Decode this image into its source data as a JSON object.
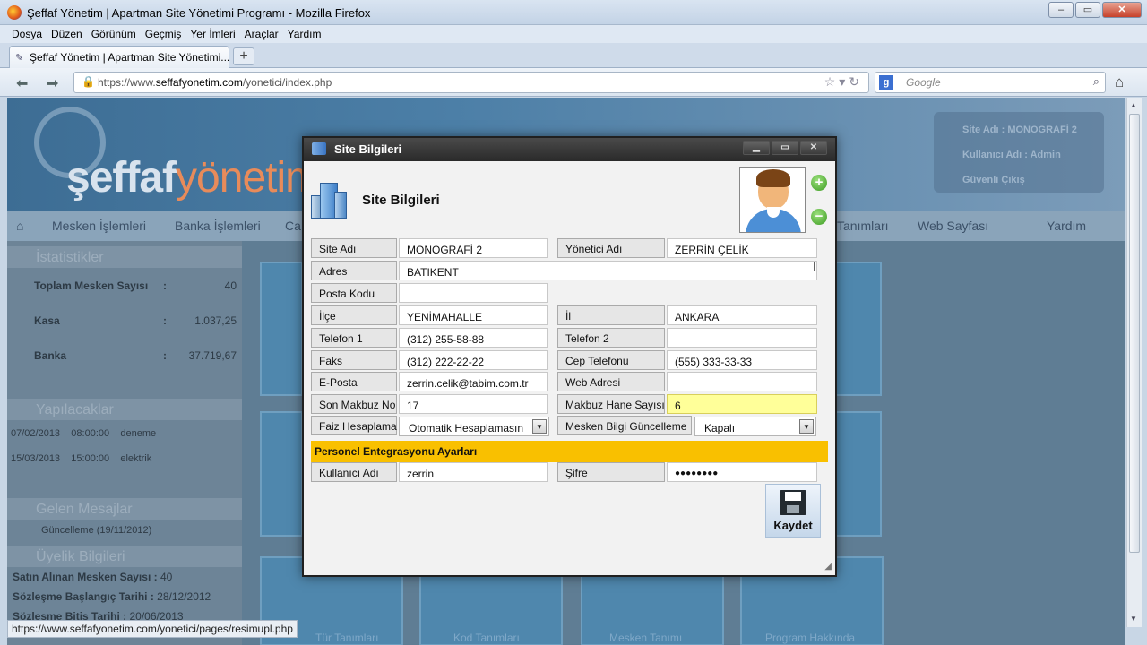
{
  "browser": {
    "window_title": "Şeffaf Yönetim | Apartman Site Yönetimi Programı - Mozilla Firefox",
    "menu": [
      "Dosya",
      "Düzen",
      "Görünüm",
      "Geçmiş",
      "Yer İmleri",
      "Araçlar",
      "Yardım"
    ],
    "tab_title": "Şeffaf Yönetim | Apartman Site Yönetimi...",
    "url_prefix": "https://www.",
    "url_domain": "seffafyonetim.com",
    "url_path": "/yonetici/index.php",
    "search_placeholder": "Google",
    "status_url": "https://www.seffafyonetim.com/yonetici/pages/resimupl.php"
  },
  "site": {
    "logo_main": "şeffaf",
    "logo_accent": "yönetim",
    "nav": [
      "Mesken İşlemleri",
      "Banka İşlemleri",
      "Ca",
      "Tanımları",
      "Web Sayfası",
      "Yardım"
    ],
    "user_box": {
      "site_name": "Site Adı : MONOGRAFİ 2",
      "user_name": "Kullanıcı Adı : Admin",
      "logout": "Güvenli Çıkış"
    },
    "sections": {
      "stats": "İstatistikler",
      "todo": "Yapılacaklar",
      "messages": "Gelen Mesajlar",
      "membership": "Üyelik Bilgileri"
    },
    "stats": [
      {
        "label": "Toplam Mesken Sayısı",
        "value": "40"
      },
      {
        "label": "Kasa",
        "value": "1.037,25"
      },
      {
        "label": "Banka",
        "value": "37.719,67"
      }
    ],
    "todo": [
      {
        "date": "07/02/2013",
        "time": "08:00:00",
        "text": "deneme"
      },
      {
        "date": "15/03/2013",
        "time": "15:00:00",
        "text": "elektrik"
      }
    ],
    "message": "Güncelleme (19/11/2012)",
    "membership": [
      {
        "label": "Satın Alınan Mesken Sayısı",
        "value": "40"
      },
      {
        "label": "Sözleşme Başlangıç Tarihi",
        "value": "28/12/2012"
      },
      {
        "label": "Sözleşme Bitiş Tarihi",
        "value": "20/06/2013"
      }
    ],
    "tile_labels": [
      "Tür Tanımları",
      "Kod Tanımları",
      "Mesken Tanımı",
      "Program Hakkında"
    ]
  },
  "dialog": {
    "title": "Site Bilgileri",
    "heading": "Site Bilgileri",
    "fields": {
      "site_adi": {
        "label": "Site Adı",
        "value": "MONOGRAFİ 2"
      },
      "yonetici_adi": {
        "label": "Yönetici Adı",
        "value": "ZERRİN ÇELİK"
      },
      "adres": {
        "label": "Adres",
        "value": "BATIKENT"
      },
      "posta_kodu": {
        "label": "Posta Kodu",
        "value": ""
      },
      "ilce": {
        "label": "İlçe",
        "value": "YENİMAHALLE"
      },
      "il": {
        "label": "İl",
        "value": "ANKARA"
      },
      "telefon1": {
        "label": "Telefon 1",
        "value": "(312) 255-58-88"
      },
      "telefon2": {
        "label": "Telefon 2",
        "value": ""
      },
      "faks": {
        "label": "Faks",
        "value": "(312) 222-22-22"
      },
      "cep": {
        "label": "Cep Telefonu",
        "value": "(555) 333-33-33"
      },
      "eposta": {
        "label": "E-Posta",
        "value": "zerrin.celik@tabim.com.tr"
      },
      "web": {
        "label": "Web Adresi",
        "value": ""
      },
      "son_makbuz": {
        "label": "Son Makbuz No",
        "value": "17"
      },
      "makbuz_hane": {
        "label": "Makbuz Hane Sayısı",
        "value": "6"
      },
      "faiz": {
        "label": "Faiz Hesaplama",
        "value": "Otomatik Hesaplamasın"
      },
      "mesken_bilgi": {
        "label": "Mesken Bilgi Güncelleme",
        "value": "Kapalı"
      }
    },
    "personel_section": "Personel Entegrasyonu Ayarları",
    "kullanici": {
      "label": "Kullanıcı Adı",
      "value": "zerrin"
    },
    "sifre": {
      "label": "Şifre",
      "value": "●●●●●●●●"
    },
    "save_label": "Kaydet"
  }
}
